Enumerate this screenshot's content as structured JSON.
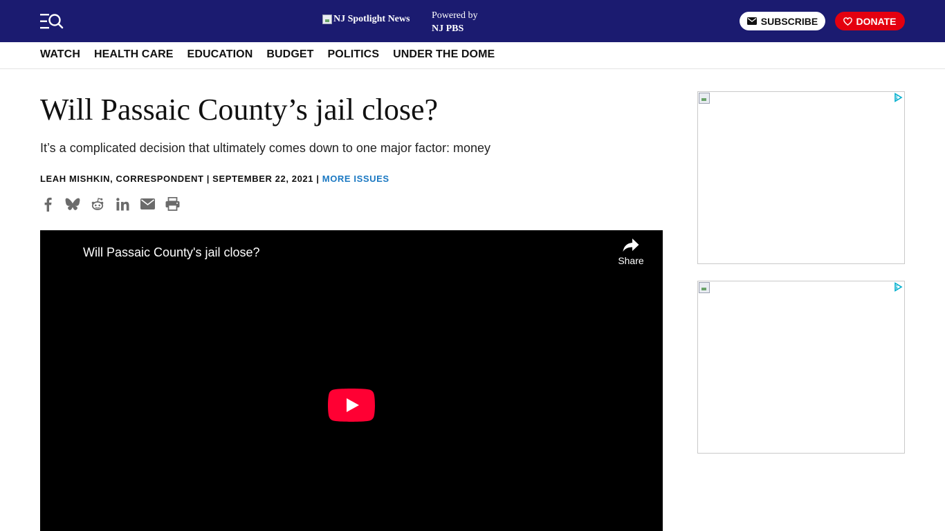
{
  "header": {
    "logo_alt": "NJ Spotlight News",
    "powered_by_label": "Powered by",
    "powered_by_brand": "NJ PBS",
    "subscribe_label": "SUBSCRIBE",
    "donate_label": "DONATE",
    "colors": {
      "bar": "#1b1b70",
      "donate": "#e4000f",
      "link": "#1a78c2"
    }
  },
  "nav": {
    "items": [
      {
        "label": "WATCH"
      },
      {
        "label": "HEALTH CARE"
      },
      {
        "label": "EDUCATION"
      },
      {
        "label": "BUDGET"
      },
      {
        "label": "POLITICS"
      },
      {
        "label": "UNDER THE DOME"
      }
    ]
  },
  "article": {
    "headline": "Will Passaic County’s jail close?",
    "dek": "It’s a complicated decision that ultimately comes down to one major factor: money",
    "byline_author": "LEAH MISHKIN, CORRESPONDENT",
    "byline_sep1": " | ",
    "byline_date": "SEPTEMBER 22, 2021",
    "byline_sep2": " | ",
    "byline_link": "MORE ISSUES",
    "share_icons": [
      "facebook-icon",
      "bluesky-icon",
      "reddit-icon",
      "linkedin-icon",
      "email-icon",
      "print-icon"
    ]
  },
  "video": {
    "title": "Will Passaic County's jail close?",
    "share_label": "Share"
  },
  "sidebar": {
    "ads": [
      {
        "icon": "broken-image-icon",
        "choices_icon": "adchoices-icon"
      },
      {
        "icon": "broken-image-icon",
        "choices_icon": "adchoices-icon"
      }
    ]
  }
}
